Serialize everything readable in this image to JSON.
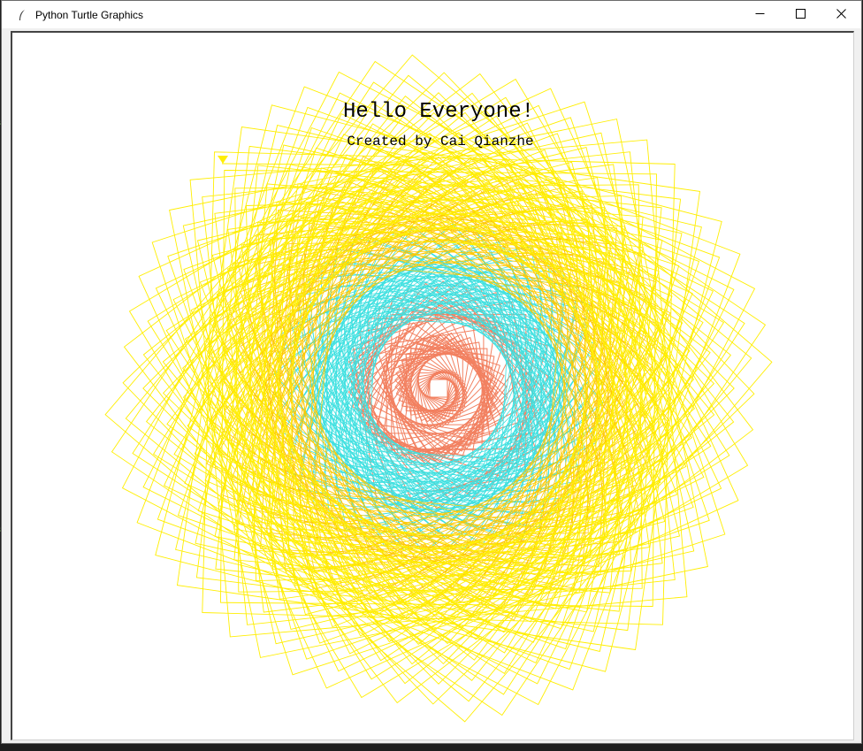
{
  "window": {
    "title": "Python Turtle Graphics",
    "controls": {
      "minimize_icon": "minimize-icon",
      "maximize_icon": "maximize-icon",
      "close_icon": "close-icon"
    }
  },
  "canvas": {
    "heading": "Hello Everyone!",
    "credit": "Created by Cai Qianzhe",
    "background": "#ffffff",
    "colors": {
      "outer_squares": "#ffee00",
      "middle_squares": "#ffc800",
      "inner_mesh": "#3de0e0",
      "core_spiral": "#f28060",
      "turtle_cursor": "#ffee00"
    },
    "turtle_icon": "triangle-arrow-icon"
  },
  "background_editor": {
    "colors": {
      "keyword": "#4fc1ff",
      "comment": "#6a9955"
    }
  }
}
